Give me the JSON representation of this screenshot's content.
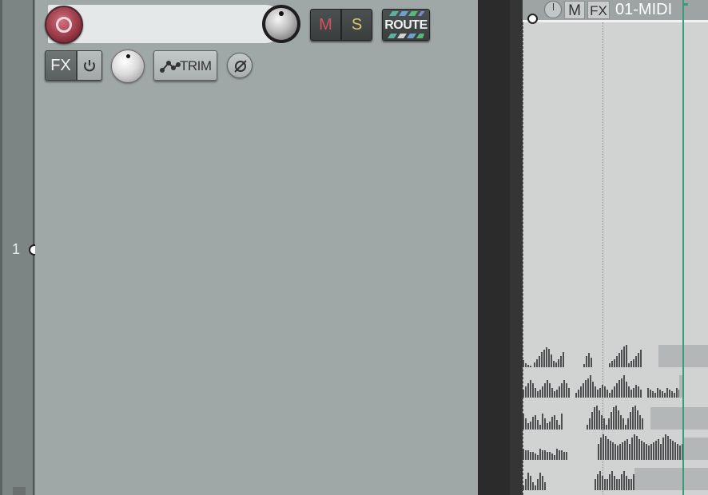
{
  "track": {
    "number": "1",
    "name": "",
    "mute_label": "M",
    "solo_label": "S",
    "route_label": "ROUTE",
    "fx_label": "FX",
    "trim_label": "TRIM"
  },
  "media_item": {
    "vol_label": "",
    "mute_label": "M",
    "fx_label": "FX",
    "name": "01-MIDI"
  },
  "colors": {
    "record_arm": "#b64a5a",
    "mute": "#d5545c",
    "solo": "#d9c86a",
    "playback_cursor": "#3a9a7a",
    "arrange_bg": "#d1d3d3",
    "track_panel_bg": "#a0a7a7"
  },
  "icons": {
    "record": "record-arm-icon",
    "power": "power-icon",
    "trim": "envelope-trim-icon",
    "phase": "phase-invert-icon"
  }
}
